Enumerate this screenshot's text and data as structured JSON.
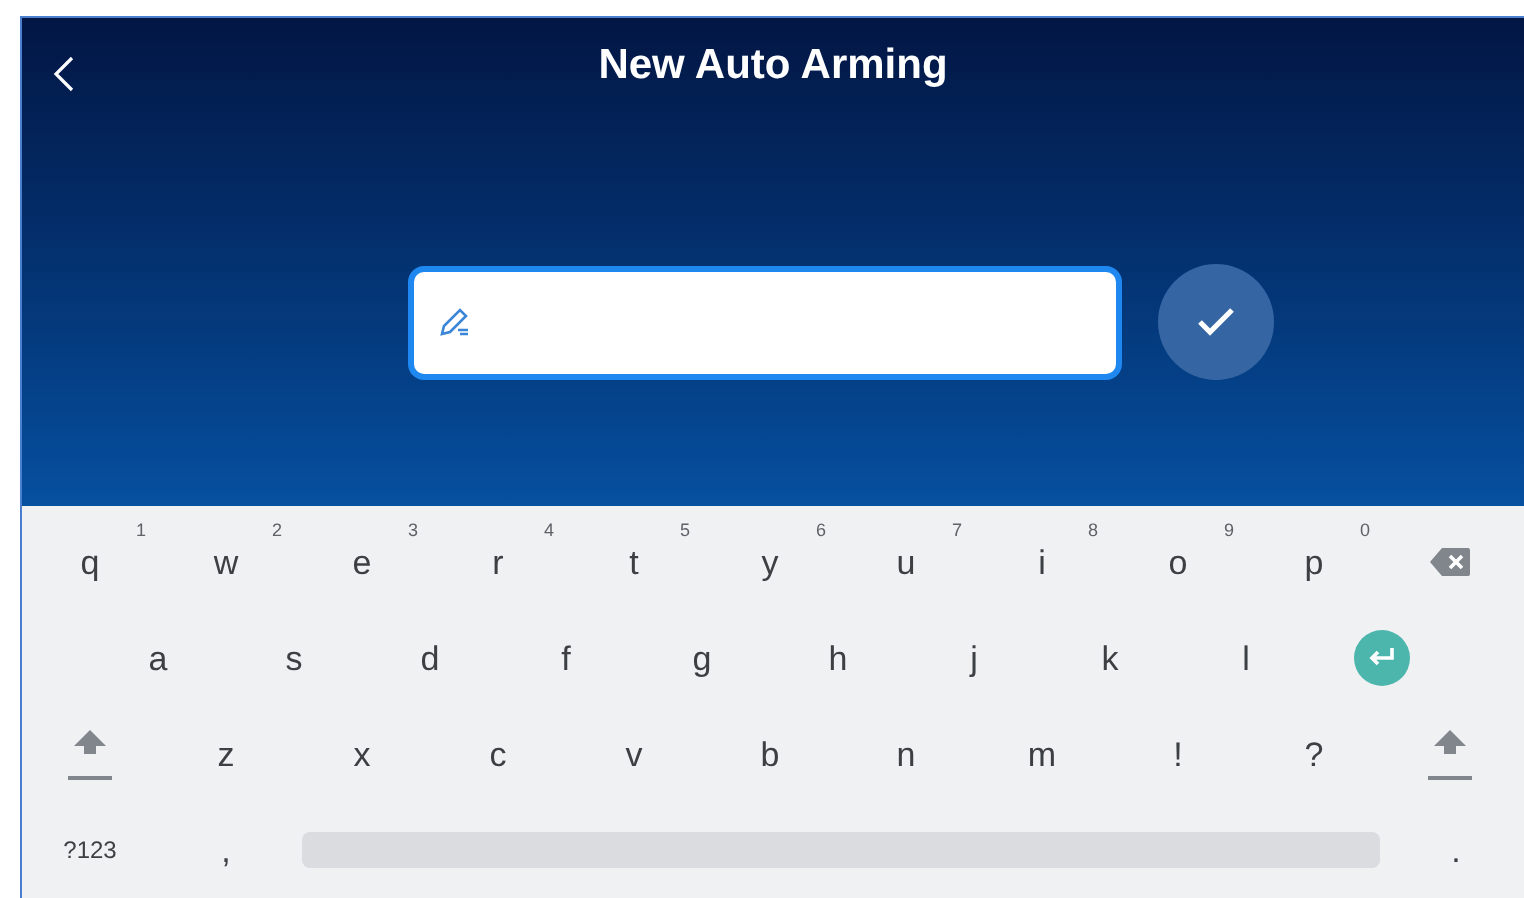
{
  "header": {
    "title": "New Auto Arming"
  },
  "name_field": {
    "focused": true
  },
  "keyboard": {
    "rows": [
      [
        {
          "kind": "letter",
          "label": "q",
          "hint": "1"
        },
        {
          "kind": "letter",
          "label": "w",
          "hint": "2"
        },
        {
          "kind": "letter",
          "label": "e",
          "hint": "3"
        },
        {
          "kind": "letter",
          "label": "r",
          "hint": "4"
        },
        {
          "kind": "letter",
          "label": "t",
          "hint": "5"
        },
        {
          "kind": "letter",
          "label": "y",
          "hint": "6"
        },
        {
          "kind": "letter",
          "label": "u",
          "hint": "7"
        },
        {
          "kind": "letter",
          "label": "i",
          "hint": "8"
        },
        {
          "kind": "letter",
          "label": "o",
          "hint": "9"
        },
        {
          "kind": "letter",
          "label": "p",
          "hint": "0"
        },
        {
          "kind": "backspace"
        }
      ],
      [
        {
          "kind": "letter",
          "label": "a"
        },
        {
          "kind": "letter",
          "label": "s"
        },
        {
          "kind": "letter",
          "label": "d"
        },
        {
          "kind": "letter",
          "label": "f"
        },
        {
          "kind": "letter",
          "label": "g"
        },
        {
          "kind": "letter",
          "label": "h"
        },
        {
          "kind": "letter",
          "label": "j"
        },
        {
          "kind": "letter",
          "label": "k"
        },
        {
          "kind": "letter",
          "label": "l"
        },
        {
          "kind": "enter"
        }
      ],
      [
        {
          "kind": "shift"
        },
        {
          "kind": "letter",
          "label": "z"
        },
        {
          "kind": "letter",
          "label": "x"
        },
        {
          "kind": "letter",
          "label": "c"
        },
        {
          "kind": "letter",
          "label": "v"
        },
        {
          "kind": "letter",
          "label": "b"
        },
        {
          "kind": "letter",
          "label": "n"
        },
        {
          "kind": "letter",
          "label": "m"
        },
        {
          "kind": "letter",
          "label": "!"
        },
        {
          "kind": "letter",
          "label": "?"
        },
        {
          "kind": "shift"
        }
      ],
      [
        {
          "kind": "small",
          "label": "?123"
        },
        {
          "kind": "letter",
          "label": ","
        },
        {
          "kind": "space"
        },
        {
          "kind": "letter",
          "label": "."
        }
      ]
    ]
  }
}
